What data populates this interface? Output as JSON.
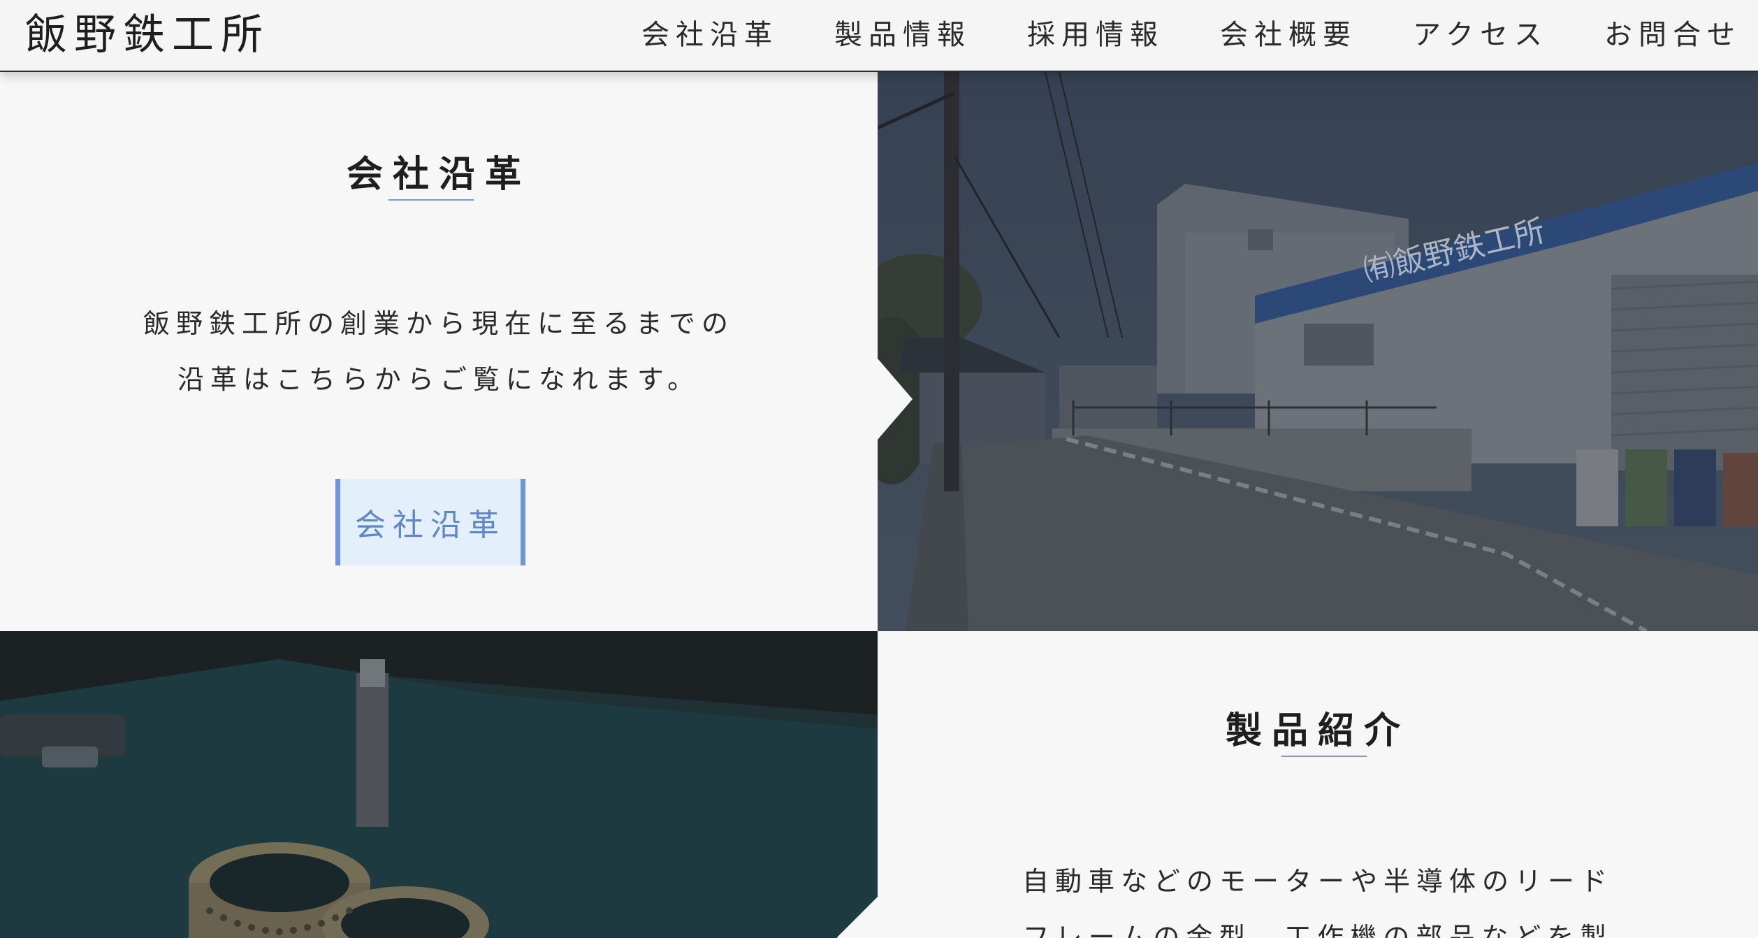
{
  "header": {
    "logo": "飯野鉄工所",
    "nav": [
      "会社沿革",
      "製品情報",
      "採用情報",
      "会社概要",
      "アクセス",
      "お問合せ"
    ]
  },
  "history": {
    "title": "会社沿革",
    "body_line1": "飯野鉄工所の創業から現在に至るまでの",
    "body_line2": "沿革はこちらからご覧になれます。",
    "button": "会社沿革"
  },
  "factory_photo": {
    "signboard": "㈲飯野鉄工所"
  },
  "products": {
    "title": "製品紹介",
    "body_line1": "自動車などのモーターや半導体のリード",
    "body_line2": "フレームの金型、工作機の部品などを製"
  },
  "colors": {
    "accent": "#6f94d8",
    "button_bg": "#e3effb",
    "panel_bg": "#f7f7f7"
  }
}
